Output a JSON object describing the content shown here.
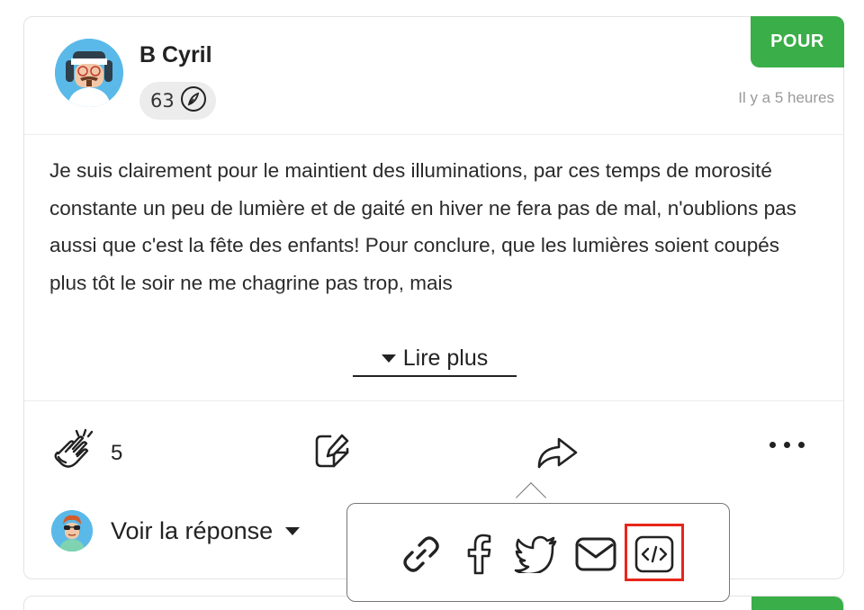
{
  "post": {
    "author": "B Cyril",
    "score": "63",
    "timestamp": "Il y a 5 heures",
    "stance_badge": "POUR",
    "text": "Je suis clairement pour le maintient des illuminations, par ces temps de morosité constante un peu de lumière et de gaité en hiver ne fera pas de mal, n'oublions pas aussi que c'est la fête des enfants! Pour conclure, que les lumières soient coupés plus tôt le soir ne me chagrine pas trop, mais",
    "read_more_label": "Lire plus",
    "clap_count": "5",
    "reply_label": "Voir la réponse"
  },
  "colors": {
    "pour_green": "#3aae48",
    "highlight_red": "#e8261a"
  },
  "share_menu": {
    "items": [
      "link-icon",
      "facebook-icon",
      "twitter-icon",
      "mail-icon",
      "embed-code-icon"
    ],
    "highlighted": "embed-code-icon"
  }
}
